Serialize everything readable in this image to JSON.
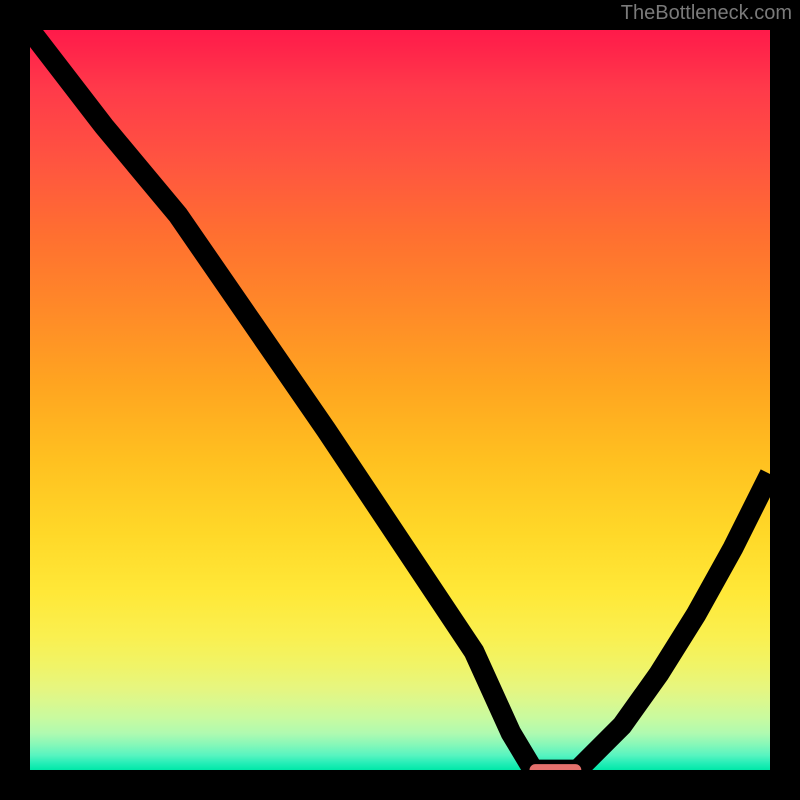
{
  "watermark": "TheBottleneck.com",
  "chart_data": {
    "type": "line",
    "title": "",
    "xlabel": "",
    "ylabel": "",
    "xlim": [
      0,
      100
    ],
    "ylim": [
      0,
      100
    ],
    "gradient_bg": {
      "top_color": "#ff1a4a",
      "bottom_color": "#00e8a8"
    },
    "series": [
      {
        "name": "left-curve",
        "x": [
          0,
          10,
          20,
          30,
          40,
          50,
          60,
          65,
          68
        ],
        "y": [
          100,
          87,
          75,
          60.5,
          46,
          31,
          16,
          5,
          0
        ]
      },
      {
        "name": "valley-floor",
        "x": [
          68,
          74
        ],
        "y": [
          0,
          0
        ]
      },
      {
        "name": "right-curve",
        "x": [
          74,
          80,
          85,
          90,
          95,
          100
        ],
        "y": [
          0,
          6,
          13,
          21,
          30,
          40
        ]
      }
    ],
    "marker": {
      "name": "optimal-marker",
      "x_center": 71,
      "y": 0,
      "width": 7,
      "color": "#e4706c"
    }
  }
}
